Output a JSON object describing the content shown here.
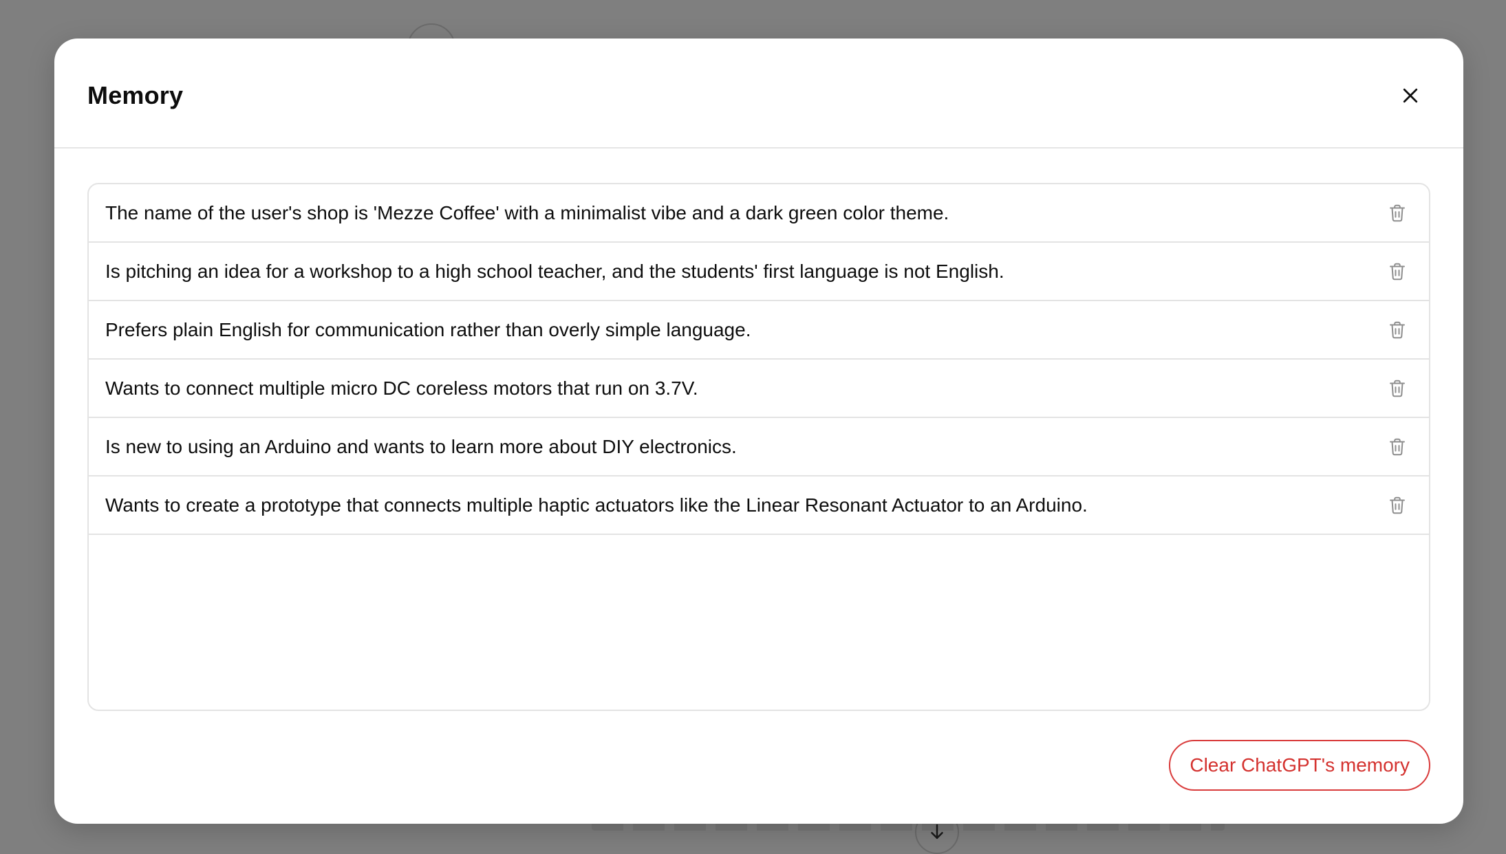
{
  "modal": {
    "title": "Memory",
    "close_icon": "close-icon",
    "clear_label": "Clear ChatGPT's memory",
    "accent_color": "#d4322f"
  },
  "memories": [
    {
      "text": "The name of the user's shop is 'Mezze Coffee' with a minimalist vibe and a dark green color theme.",
      "icon": "trash-icon"
    },
    {
      "text": "Is pitching an idea for a workshop to a high school teacher, and the students' first language is not English.",
      "icon": "trash-icon"
    },
    {
      "text": "Prefers plain English for communication rather than overly simple language.",
      "icon": "trash-icon"
    },
    {
      "text": "Wants to connect multiple micro DC coreless motors that run on 3.7V.",
      "icon": "trash-icon"
    },
    {
      "text": "Is new to using an Arduino and wants to learn more about DIY electronics.",
      "icon": "trash-icon"
    },
    {
      "text": "Wants to create a prototype that connects multiple haptic actuators like the Linear Resonant Actuator to an Arduino.",
      "icon": "trash-icon"
    }
  ],
  "background": {
    "scroll_down_icon": "arrow-down-icon"
  }
}
